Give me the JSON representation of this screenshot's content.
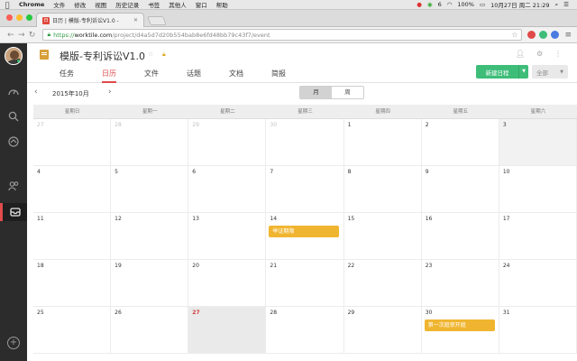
{
  "mac_menu": {
    "app": "Chrome",
    "items": [
      "文件",
      "修改",
      "视图",
      "历史记录",
      "书签",
      "其他人",
      "窗口",
      "帮助"
    ],
    "status": {
      "battery": "100%",
      "clock": "10月27日 周二 21:29",
      "badge": "6"
    }
  },
  "browser": {
    "tab_title": "日历 | 模版-专利诉讼V1.0 -",
    "tab_favicon": "日",
    "url_scheme": "https://",
    "url_host": "worktile.com",
    "url_path": "/project/d4a5d7d20b554bab8e6fd48bb79c43f7/event"
  },
  "project": {
    "title": "模版-专利诉讼V1.0",
    "tabs": [
      {
        "label": "任务",
        "active": false
      },
      {
        "label": "日历",
        "active": true
      },
      {
        "label": "文件",
        "active": false
      },
      {
        "label": "话题",
        "active": false
      },
      {
        "label": "文档",
        "active": false
      },
      {
        "label": "简报",
        "active": false
      }
    ],
    "new_event_label": "新建日程",
    "filter_label": "全部"
  },
  "calendar": {
    "month_label": "2015年10月",
    "view_month": "月",
    "view_week": "周",
    "weekdays": [
      "星期日",
      "星期一",
      "星期二",
      "星期三",
      "星期四",
      "星期五",
      "星期六"
    ],
    "weeks": [
      [
        {
          "d": "27",
          "other": true
        },
        {
          "d": "28",
          "other": true
        },
        {
          "d": "29",
          "other": true
        },
        {
          "d": "30",
          "other": true
        },
        {
          "d": "1"
        },
        {
          "d": "2"
        },
        {
          "d": "3",
          "shaded": true
        }
      ],
      [
        {
          "d": "4"
        },
        {
          "d": "5"
        },
        {
          "d": "6"
        },
        {
          "d": "7"
        },
        {
          "d": "8"
        },
        {
          "d": "9"
        },
        {
          "d": "10"
        }
      ],
      [
        {
          "d": "11"
        },
        {
          "d": "12"
        },
        {
          "d": "13"
        },
        {
          "d": "14",
          "event": "举证期限"
        },
        {
          "d": "15"
        },
        {
          "d": "16"
        },
        {
          "d": "17"
        }
      ],
      [
        {
          "d": "18"
        },
        {
          "d": "19"
        },
        {
          "d": "20"
        },
        {
          "d": "21"
        },
        {
          "d": "22"
        },
        {
          "d": "23"
        },
        {
          "d": "24"
        }
      ],
      [
        {
          "d": "25"
        },
        {
          "d": "26"
        },
        {
          "d": "27",
          "today": true
        },
        {
          "d": "28"
        },
        {
          "d": "29"
        },
        {
          "d": "30",
          "event": "第一次庭审开庭"
        },
        {
          "d": "31"
        }
      ]
    ]
  },
  "colors": {
    "accent_red": "#e04a4a",
    "event_yellow": "#f0b530",
    "primary_green": "#3ebd79",
    "sidebar_dark": "#2c2c2c"
  }
}
